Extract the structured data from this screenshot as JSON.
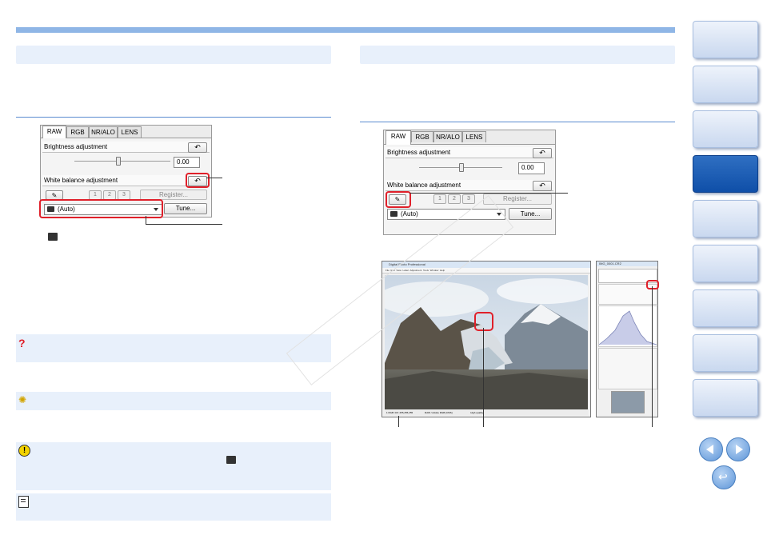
{
  "left_panel": {
    "tabs": [
      "RAW",
      "RGB",
      "NR/ALO",
      "LENS"
    ],
    "brightness_label": "Brightness adjustment",
    "brightness_value": "0.00",
    "wb_label": "White balance adjustment",
    "presets": [
      "1",
      "2",
      "3"
    ],
    "register_label": "Register...",
    "wb_select": "(Auto)",
    "tune_label": "Tune..."
  },
  "right_panel": {
    "tabs": [
      "RAW",
      "RGB",
      "NR/ALO",
      "LENS"
    ],
    "brightness_label": "Brightness adjustment",
    "brightness_value": "0.00",
    "wb_label": "White balance adjustment",
    "presets": [
      "1",
      "2",
      "3"
    ],
    "register_label": "Register...",
    "wb_select": "(Auto)",
    "tune_label": "Tune..."
  },
  "screenshot": {
    "title": "Digital Photo Professional",
    "menu": [
      "File",
      "Edit",
      "View",
      "Label",
      "Adjustment",
      "Tools",
      "Window",
      "Help"
    ],
    "status_left": "1 RGB: 0/0: 255,255,255",
    "status_mid": "RAW / Adobe RGB [CMS]",
    "status_right": "High quality",
    "palette_title": "IMG_0001.CR2"
  },
  "colors": {
    "accent_bar": "#8fb6e6",
    "section_bg": "#e8f0fb",
    "highlight_red": "#e0202a",
    "nav_active": "#0f4fa8"
  },
  "icons": [
    "camera-icon",
    "question-icon",
    "lightbulb-icon",
    "caution-icon",
    "memo-icon",
    "undo-icon",
    "eyedropper-icon",
    "prev-page-icon",
    "next-page-icon",
    "return-icon"
  ]
}
